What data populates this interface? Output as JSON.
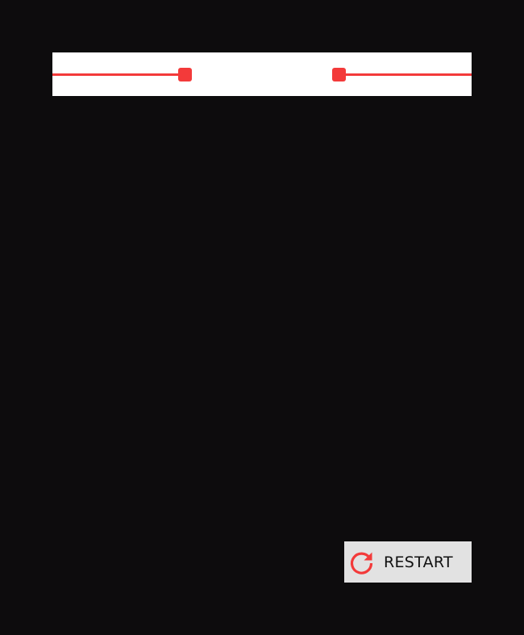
{
  "range_slider": {
    "accent_color": "#f33a3a",
    "panel_color": "#ffffff",
    "handles": [
      "min-handle",
      "max-handle"
    ]
  },
  "restart": {
    "label": "RESTART",
    "icon": "refresh-icon",
    "icon_color": "#f33a3a",
    "background": "#e2e2e2"
  },
  "background_color": "#0d0c0d"
}
